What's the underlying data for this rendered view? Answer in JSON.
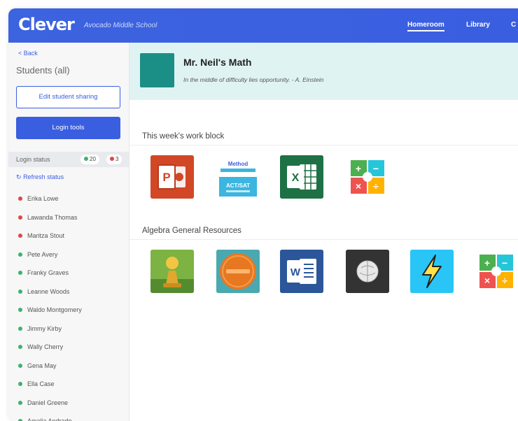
{
  "header": {
    "logo": "Clever",
    "school": "Avocado Middle School",
    "nav": [
      "Homeroom",
      "Library",
      "C"
    ]
  },
  "sidebar": {
    "back": "< Back",
    "title": "Students (all)",
    "edit_sharing": "Edit student sharing",
    "login_tools": "Login tools",
    "login_status": "Login status",
    "online_count": "20",
    "offline_count": "3",
    "refresh": "Refresh status",
    "students": [
      {
        "name": "Erika Lowe",
        "status": "offline"
      },
      {
        "name": "Lawanda Thomas",
        "status": "offline"
      },
      {
        "name": "Maritza Stout",
        "status": "offline"
      },
      {
        "name": "Pete Avery",
        "status": "online"
      },
      {
        "name": "Franky Graves",
        "status": "online"
      },
      {
        "name": "Leanne Woods",
        "status": "online"
      },
      {
        "name": "Waldo Montgomery",
        "status": "online"
      },
      {
        "name": "Jimmy Kirby",
        "status": "online"
      },
      {
        "name": "Wally Cherry",
        "status": "online"
      },
      {
        "name": "Gena May",
        "status": "online"
      },
      {
        "name": "Ella Case",
        "status": "online"
      },
      {
        "name": "Daniel Greene",
        "status": "online"
      },
      {
        "name": "Amalia Andrade",
        "status": "online"
      }
    ]
  },
  "banner": {
    "teacher": "Mr. Neil's Math",
    "quote": "In the middle of difficulty lies opportunity. - A. Einstein"
  },
  "sections": [
    {
      "title": "This week's work block",
      "apps": [
        "powerpoint-icon",
        "method-test-prep-icon",
        "excel-icon",
        "math-operations-icon"
      ]
    },
    {
      "title": "Algebra General Resources",
      "apps": [
        "chess-pawn-icon",
        "mathletic-icon",
        "word-icon",
        "wikipedia-icon",
        "lightning-icon",
        "math-operations-icon"
      ]
    }
  ],
  "app_labels": {
    "method_brand": "Method",
    "method_sub": "ACT/SAT"
  },
  "colors": {
    "brand": "#3a5ee0",
    "banner": "#dff3f2",
    "avatar": "#1b8f86",
    "online": "#3cb371",
    "offline": "#e04646"
  }
}
